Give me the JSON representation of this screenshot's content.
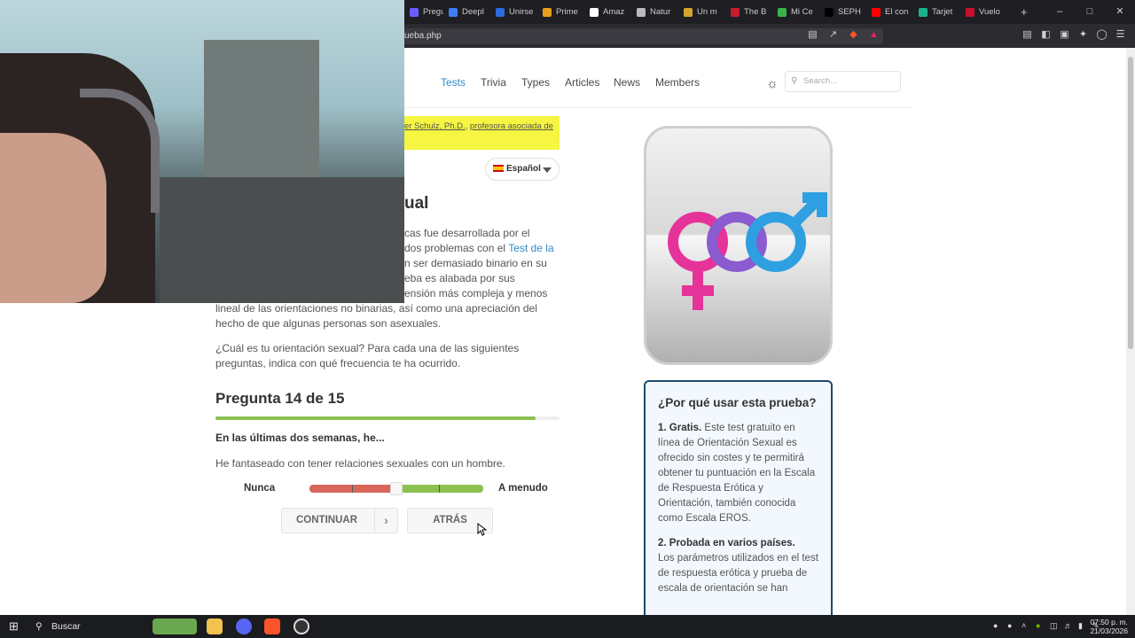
{
  "browser": {
    "tabs": [
      {
        "label": "Pregu",
        "color": "#6b5cff"
      },
      {
        "label": "Deepl",
        "color": "#3f7cf6"
      },
      {
        "label": "Unirse",
        "color": "#2d6cdf"
      },
      {
        "label": "Prime",
        "color": "#e9a01b"
      },
      {
        "label": "Amaz",
        "color": "#ffffff"
      },
      {
        "label": "Natur",
        "color": "#bbbbbb"
      },
      {
        "label": "Un m",
        "color": "#d4a52e"
      },
      {
        "label": "The B",
        "color": "#c61b2a"
      },
      {
        "label": "Mi Ce",
        "color": "#37b34a"
      },
      {
        "label": "SEPH",
        "color": "#000000"
      },
      {
        "label": "El con",
        "color": "#ff0000"
      },
      {
        "label": "Tarjet",
        "color": "#19b28c"
      },
      {
        "label": "Vuelo",
        "color": "#c8102e"
      }
    ],
    "new_tab": "+",
    "url": "ueba.php"
  },
  "nav": {
    "items": [
      "Tests",
      "Trivia",
      "Types",
      "Articles",
      "News",
      "Members"
    ],
    "active": "Tests",
    "search_placeholder": "Search..."
  },
  "notice": {
    "text_a": "er Schulz, Ph.D.",
    "text_b": "profesora asociada de"
  },
  "language": {
    "selected": "Español"
  },
  "heading_fragment": "ual",
  "intro": {
    "lines": [
      "cas fue desarrollada por el",
      "dos problemas con el",
      "n ser demasiado binario en su",
      "eba es alabada por sus",
      "ensión más compleja y menos"
    ],
    "link": "Test de la",
    "line_full_1": "lineal de las orientaciones no binarias, así como una apreciación del",
    "line_full_2": "hecho de que algunas personas son asexuales.",
    "prompt_1": "¿Cuál es tu orientación sexual? Para cada una de las siguientes",
    "prompt_2": "preguntas, indica con qué frecuencia te ha ocurrido."
  },
  "question": {
    "title": "Pregunta 14 de 15",
    "progress": 0.93,
    "lead": "En las últimas dos semanas, he...",
    "text": "He fantaseado con tener relaciones sexuales con un hombre.",
    "scale_min": "Nunca",
    "scale_max": "A menudo",
    "slider_value": 0.5,
    "continue_label": "CONTINUAR",
    "back_label": "ATRÁS"
  },
  "sidebar": {
    "card_title": "¿Por qué usar esta prueba?",
    "point1_title": "1. Gratis.",
    "point1_text": "Este test gratuito en línea de Orientación Sexual es ofrecido sin costes y te permitirá obtener tu puntuación en la Escala de Respuesta Erótica y Orientación, también conocida como Escala EROS.",
    "point2_title": "2. Probada en varios países.",
    "point2_text": "Los parámetros utilizados en el test de respuesta erótica y prueba de escala de orientación se han"
  },
  "taskbar": {
    "search_label": "Buscar",
    "time": "07:50 p. m.",
    "date": "21/03/2026"
  },
  "colors": {
    "accent": "#2d8bc7",
    "progress": "#8cc152",
    "slider_red": "#d9665b",
    "slider_green": "#8cc152",
    "highlight": "#f5f542",
    "card_border": "#1d4a6e"
  }
}
